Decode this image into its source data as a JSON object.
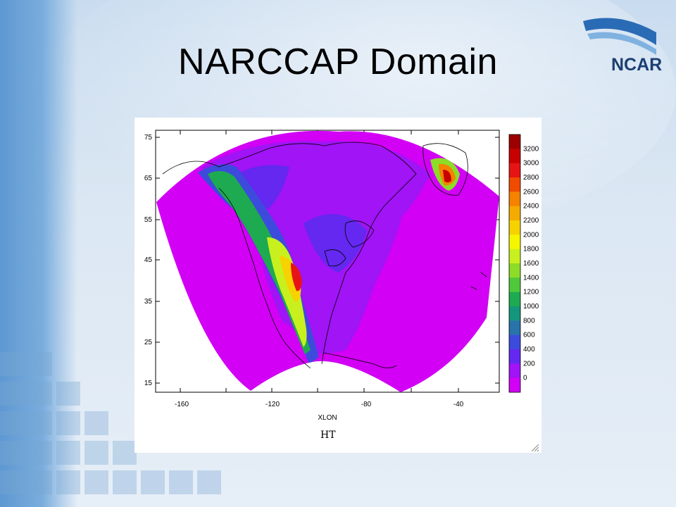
{
  "slide": {
    "title": "NARCCAP Domain",
    "logo": {
      "text": "NCAR",
      "color": "#1b3f73"
    }
  },
  "map": {
    "variable_label": "HT",
    "x_axis_label": "XLON",
    "x_ticks": [
      "-160",
      "-120",
      "-80",
      "-40"
    ],
    "y_ticks": [
      "75",
      "65",
      "55",
      "45",
      "35",
      "25",
      "15"
    ],
    "colorbar": {
      "labels": [
        "3200",
        "3000",
        "2800",
        "2600",
        "2400",
        "2200",
        "2000",
        "1800",
        "1600",
        "1400",
        "1200",
        "1000",
        "800",
        "600",
        "400",
        "200",
        "0"
      ],
      "colors": [
        "#9c0000",
        "#c80000",
        "#e61414",
        "#f04b00",
        "#f58200",
        "#f5aa00",
        "#f5d200",
        "#f5f500",
        "#c8f01e",
        "#8cdc28",
        "#50c83c",
        "#1eaa50",
        "#14967d",
        "#2873aa",
        "#3c4bdc",
        "#6428f0",
        "#a014f5",
        "#d200f5"
      ]
    }
  }
}
